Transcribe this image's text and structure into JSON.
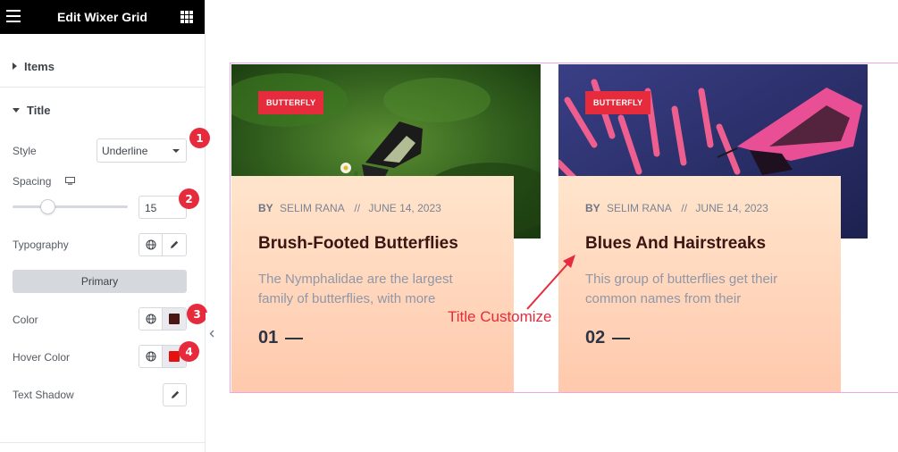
{
  "panel": {
    "title": "Edit Wixer Grid",
    "sections": {
      "items": "Items",
      "title": "Title"
    },
    "controls": {
      "style_label": "Style",
      "style_value": "Underline",
      "spacing_label": "Spacing",
      "spacing_value": "15",
      "typography_label": "Typography",
      "primary_label": "Primary",
      "color_label": "Color",
      "color_value": "#4a1712",
      "hover_color_label": "Hover Color",
      "hover_color_value": "#e51111",
      "text_shadow_label": "Text Shadow"
    },
    "badges": [
      "1",
      "2",
      "3",
      "4"
    ]
  },
  "cards": [
    {
      "tag": "BUTTERFLY",
      "by": "BY",
      "author": "SELIM RANA",
      "sep": "//",
      "date": "JUNE 14, 2023",
      "title": "Brush-Footed Butterflies",
      "desc_line1": "The Nymphalidae are the largest",
      "desc_line2": "family of butterflies, with more",
      "number": "01"
    },
    {
      "tag": "BUTTERFLY",
      "by": "BY",
      "author": "SELIM RANA",
      "sep": "//",
      "date": "JUNE 14, 2023",
      "title": "Blues And Hairstreaks",
      "desc_line1": "This group of butterflies get their",
      "desc_line2": "common names from their",
      "number": "02"
    }
  ],
  "annotation": "Title Customize",
  "colors": {
    "accent": "#e62b3c",
    "frame": "#e7a8e8",
    "title_color": "#3a1512"
  }
}
